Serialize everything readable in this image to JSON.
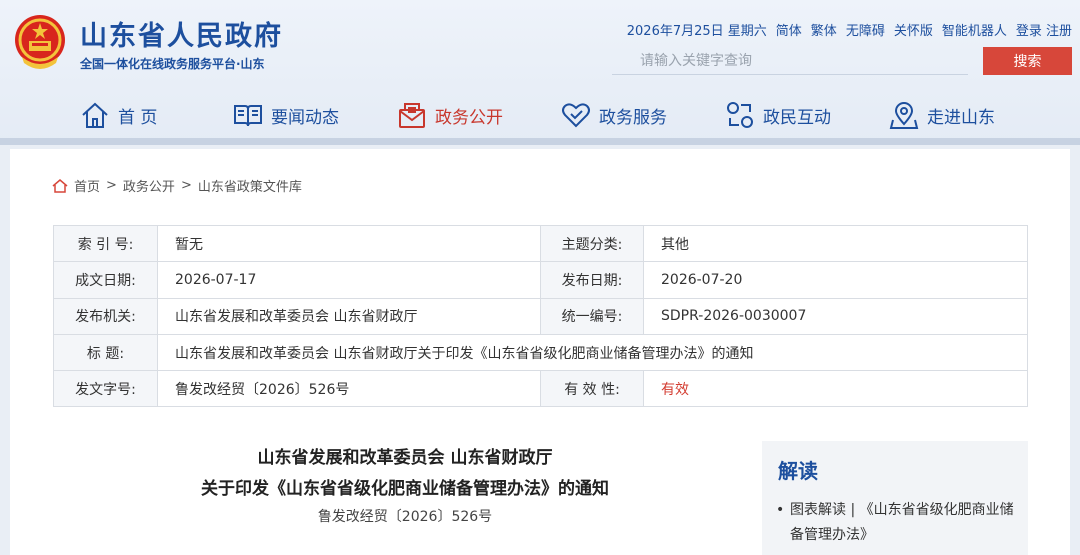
{
  "header": {
    "title": "山东省人民政府",
    "subtitle": "全国一体化在线政务服务平台·山东",
    "top_links": [
      "2026年7月25日 星期六",
      "简体",
      "繁体",
      "无障碍",
      "关怀版",
      "智能机器人",
      "登录 注册"
    ],
    "search": {
      "placeholder": "请输入关键字查询",
      "button": "搜索"
    }
  },
  "nav": {
    "items": [
      {
        "label": "首 页",
        "icon": "home-icon"
      },
      {
        "label": "要闻动态",
        "icon": "book-icon"
      },
      {
        "label": "政务公开",
        "icon": "mail-icon",
        "active": true
      },
      {
        "label": "政务服务",
        "icon": "heart-icon"
      },
      {
        "label": "政民互动",
        "icon": "exchange-icon"
      },
      {
        "label": "走进山东",
        "icon": "location-icon"
      }
    ]
  },
  "breadcrumb": [
    "首页",
    "政务公开",
    "山东省政策文件库"
  ],
  "meta": {
    "index_label": "索 引 号:",
    "index_value": "暂无",
    "topic_label": "主题分类:",
    "topic_value": "其他",
    "written_label": "成文日期:",
    "written_value": "2026-07-17",
    "published_label": "发布日期:",
    "published_value": "2026-07-20",
    "issuer_label": "发布机关:",
    "issuer_value": "山东省发展和改革委员会 山东省财政厅",
    "code_label": "统一编号:",
    "code_value": "SDPR-2026-0030007",
    "title_label": "标 题:",
    "title_value": "山东省发展和改革委员会 山东省财政厅关于印发《山东省省级化肥商业储备管理办法》的通知",
    "docno_label": "发文字号:",
    "docno_value": "鲁发改经贸〔2026〕526号",
    "valid_label": "有 效 性:",
    "valid_value": "有效"
  },
  "document": {
    "title_line1": "山东省发展和改革委员会  山东省财政厅",
    "title_line2": "关于印发《山东省省级化肥商业储备管理办法》的通知",
    "number": "鲁发改经贸〔2026〕526号"
  },
  "sidebar": {
    "title": "解读",
    "item": "图表解读 | 《山东省省级化肥商业储备管理办法》"
  },
  "colors": {
    "brand": "#1d4f9e",
    "accent": "#d7473a",
    "active": "#c8372d"
  }
}
